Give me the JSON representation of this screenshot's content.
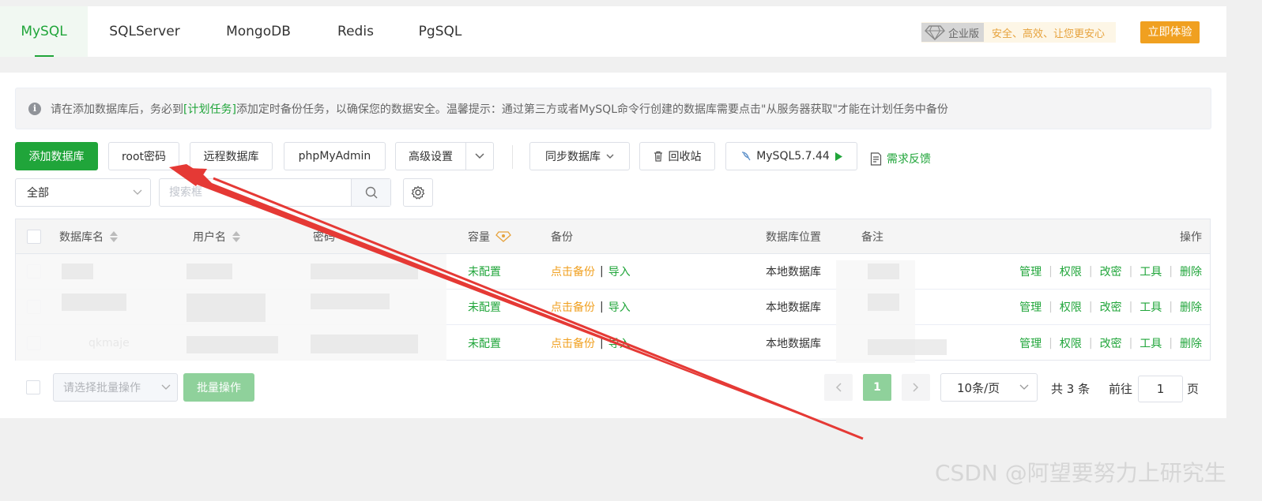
{
  "tabs": [
    {
      "label": "MySQL",
      "active": true
    },
    {
      "label": "SQLServer"
    },
    {
      "label": "MongoDB"
    },
    {
      "label": "Redis"
    },
    {
      "label": "PgSQL"
    }
  ],
  "enterprise": {
    "badge": "企业版",
    "slogan": "安全、高效、让您更安心",
    "cta": "立即体验"
  },
  "notice": {
    "text_before": "请在添加数据库后，务必到",
    "link": "[计划任务]",
    "text_after": "添加定时备份任务，以确保您的数据安全。温馨提示：通过第三方或者MySQL命令行创建的数据库需要点击\"从服务器获取\"才能在计划任务中备份"
  },
  "toolbar": {
    "add_db": "添加数据库",
    "root_pwd": "root密码",
    "remote_db": "远程数据库",
    "phpmyadmin": "phpMyAdmin",
    "advanced": "高级设置",
    "sync_db": "同步数据库",
    "recycle": "回收站",
    "mysql_version": "MySQL5.7.44",
    "feedback": "需求反馈"
  },
  "filter": {
    "scope": "全部",
    "search_placeholder": "搜索框"
  },
  "table": {
    "headers": {
      "name": "数据库名",
      "user": "用户名",
      "password": "密码",
      "capacity": "容量",
      "backup": "备份",
      "location": "数据库位置",
      "remark": "备注",
      "ops": "操作"
    },
    "rows": [
      {
        "capacity": "未配置",
        "backup": "点击备份",
        "import": "导入",
        "location": "本地数据库"
      },
      {
        "capacity": "未配置",
        "backup": "点击备份",
        "import": "导入",
        "location": "本地数据库"
      },
      {
        "capacity": "未配置",
        "backup": "点击备份",
        "import": "导入",
        "location": "本地数据库"
      }
    ],
    "ops": [
      "管理",
      "权限",
      "改密",
      "工具",
      "删除"
    ],
    "row3_name_partial": "qkmaje"
  },
  "footer": {
    "batch_placeholder": "请选择批量操作",
    "batch_btn": "批量操作",
    "page": "1",
    "page_size": "10条/页",
    "total": "共 3 条",
    "goto_prefix": "前往",
    "goto_value": "1",
    "goto_suffix": "页"
  },
  "watermark": "CSDN @阿望要努力上研究生",
  "colors": {
    "primary": "#20a53a",
    "warning": "#f0a020",
    "annotation_arrow": "#e53935"
  }
}
